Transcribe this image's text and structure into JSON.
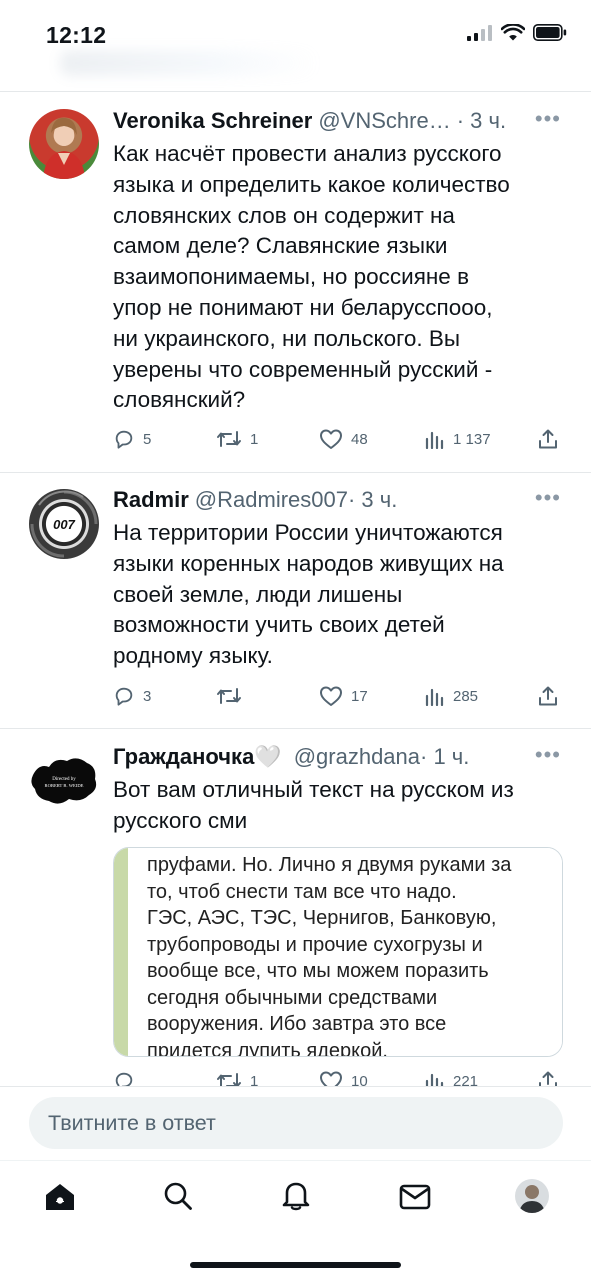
{
  "status_bar": {
    "time": "12:12"
  },
  "tweets": [
    {
      "author": "Veronika Schreiner",
      "handle": "@VNSchre…",
      "time": "· 3 ч.",
      "lines": [
        "Как насчёт провести анализ русского",
        "языка и определить какое количество",
        "словянских слов он содержит на",
        "самом деле?  Славянские языки",
        "взаимопонимаемы, но россияне в",
        "упор не понимают ни беларусспооо,",
        "ни украинского, ни польского.  Вы",
        "уверены что современный русский -",
        "словянский?"
      ],
      "replies": "5",
      "retweets": "1",
      "likes": "48",
      "views": "1 137"
    },
    {
      "author": "Radmir",
      "handle": "@Radmires007",
      "time": "· 3 ч.",
      "avatar_text": "007",
      "lines": [
        "На территории России уничтожаются",
        "языки коренных народов живущих на",
        "своей земле, люди лишены",
        "возможности учить своих детей",
        "родному языку."
      ],
      "replies": "3",
      "retweets": "",
      "likes": "17",
      "views": "285"
    },
    {
      "author": "Гражданочка🤍",
      "handle": "@grazhdana",
      "time": "· 1 ч.",
      "avatar_text_1": "Directed by",
      "avatar_text_2": "ROBERT B. WEIDE",
      "lines": [
        "Вот вам отличный текст на русском из",
        "русского сми"
      ],
      "quote_lines": [
        "пруфами. Но. Лично я двумя руками за",
        "то, чтоб снести там все что надо.",
        "ГЭС, АЭС, ТЭС, Чернигов, Банковую,",
        "трубопроводы и прочие сухогрузы и",
        "вообще все, что мы можем поразить",
        "сегодня обычными средствами",
        "вооружения. Ибо завтра это все",
        "придется лупить ядеркой."
      ],
      "replies": "",
      "retweets": "1",
      "likes": "10",
      "views": "221"
    }
  ],
  "reply_box": {
    "placeholder": "Твитните в ответ"
  },
  "tab_bar": [
    "home-icon",
    "search-icon",
    "bell-icon",
    "mail-icon",
    "profile-avatar"
  ]
}
